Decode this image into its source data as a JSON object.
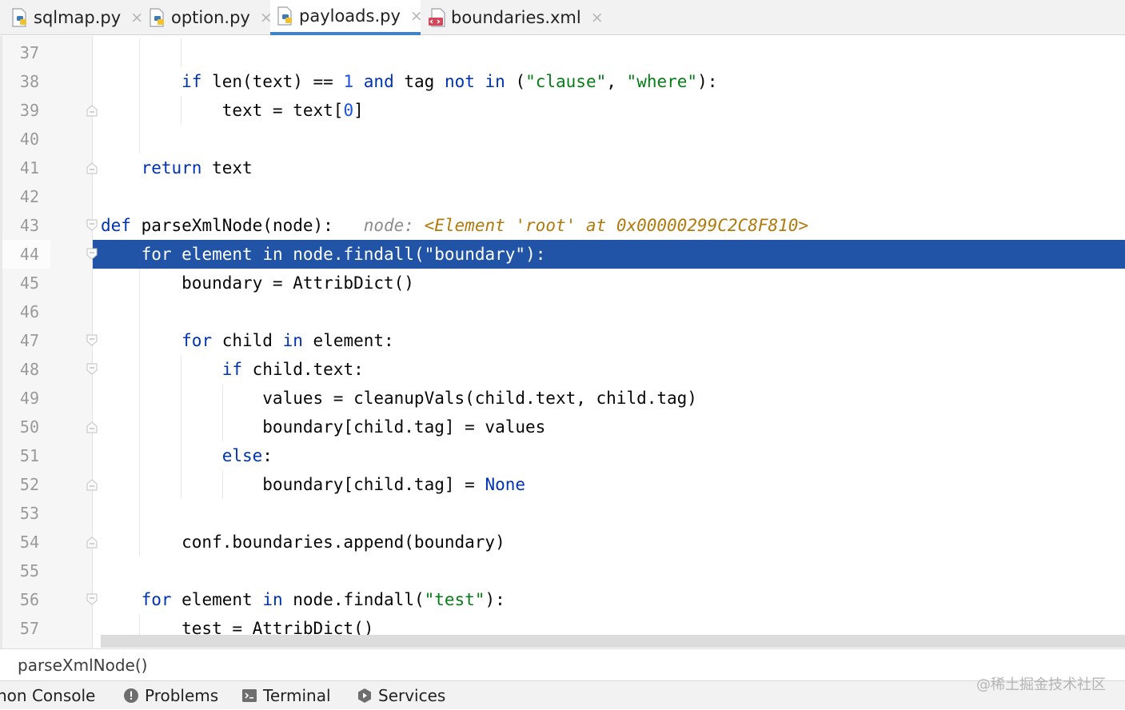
{
  "tabs": [
    {
      "label": "sqlmap.py",
      "icon": "python-file-icon",
      "active": false
    },
    {
      "label": "option.py",
      "icon": "python-file-icon",
      "active": false
    },
    {
      "label": "payloads.py",
      "icon": "python-file-icon",
      "active": true
    },
    {
      "label": "boundaries.xml",
      "icon": "xml-file-icon",
      "active": false
    }
  ],
  "close_glyph": "×",
  "editor": {
    "line_numbers": [
      "37",
      "38",
      "39",
      "40",
      "41",
      "42",
      "43",
      "44",
      "45",
      "46",
      "47",
      "48",
      "49",
      "50",
      "51",
      "52",
      "53",
      "54",
      "55",
      "56",
      "57"
    ],
    "selected_line": "44",
    "inlay_hint": {
      "label": "node:",
      "value": "<Element 'root' at 0x00000299C2C8F810>"
    },
    "colors": {
      "keyword": "#0033b3",
      "string": "#067d17",
      "number": "#1750eb",
      "selection": "#2154a6",
      "hint_value": "#b07a0d"
    }
  },
  "breadcrumb": {
    "path": "parseXmlNode()"
  },
  "tool_windows": [
    {
      "label": "hon Console",
      "icon": ""
    },
    {
      "label": "Problems",
      "icon": "info-circle-icon"
    },
    {
      "label": "Terminal",
      "icon": "terminal-icon"
    },
    {
      "label": "Services",
      "icon": "services-icon"
    }
  ],
  "watermark": "@稀土掘金技术社区"
}
